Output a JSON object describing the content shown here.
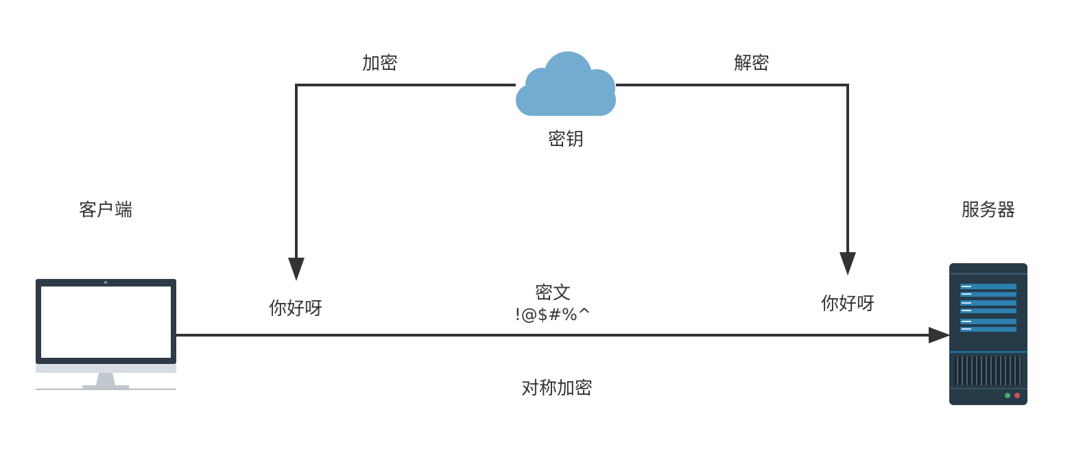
{
  "labels": {
    "client": "客户端",
    "server": "服务器",
    "encrypt": "加密",
    "decrypt": "解密",
    "key": "密钥",
    "plaintext_left": "你好呀",
    "plaintext_right": "你好呀",
    "ciphertext_title": "密文",
    "ciphertext_value": "!@$#%^",
    "caption": "对称加密"
  },
  "icons": {
    "client": "desktop-monitor-icon",
    "server": "server-rack-icon",
    "key": "cloud-icon"
  },
  "colors": {
    "line": "#333333",
    "cloud": "#73acd1",
    "monitor_frame": "#2e3a46",
    "server_body": "#263a48",
    "server_slot": "#2d7fb0"
  }
}
